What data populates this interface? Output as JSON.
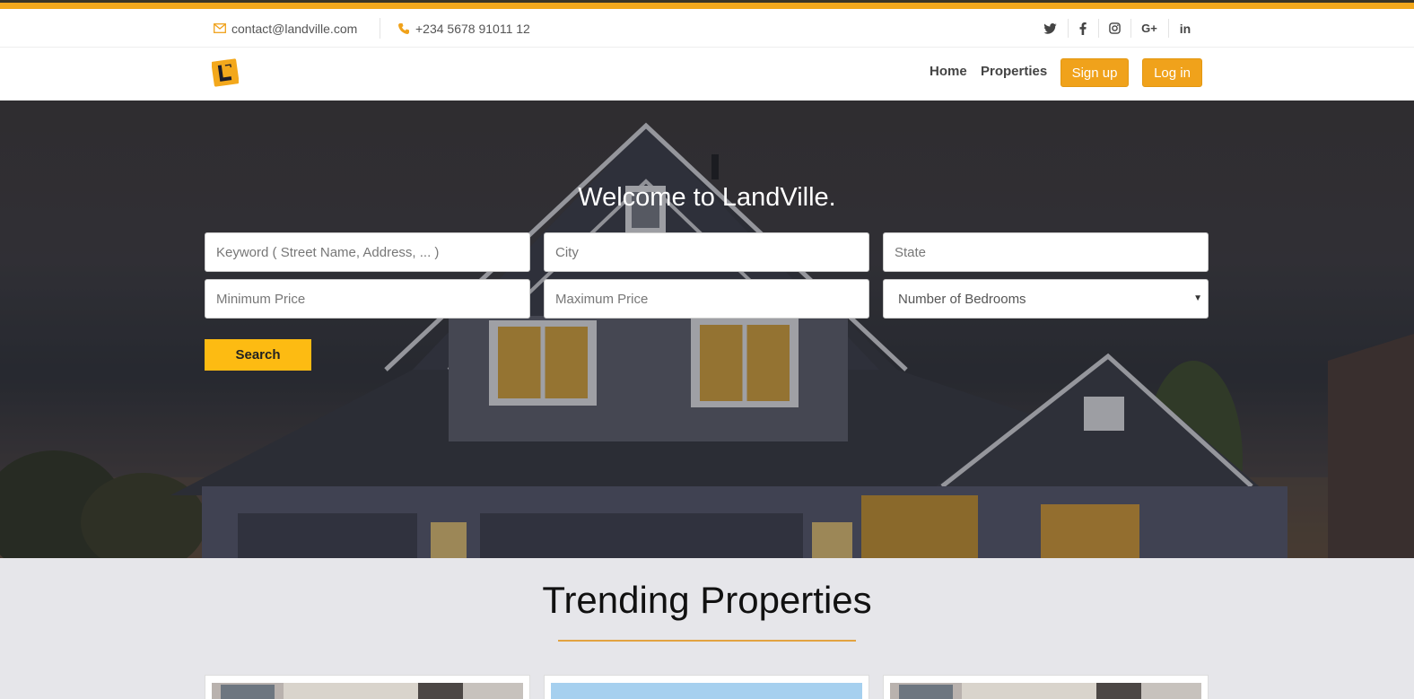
{
  "contact": {
    "email": "contact@landville.com",
    "phone": "+234 5678 91011 12"
  },
  "social": [
    {
      "icon": "twitter-icon",
      "glyph": "🐦"
    },
    {
      "icon": "facebook-icon",
      "glyph": "f"
    },
    {
      "icon": "instagram-icon",
      "glyph": "◎"
    },
    {
      "icon": "google-plus-icon",
      "glyph": "G+"
    },
    {
      "icon": "linkedin-icon",
      "glyph": "in"
    }
  ],
  "nav": {
    "home": "Home",
    "properties": "Properties",
    "signup": "Sign up",
    "login": "Log in"
  },
  "hero": {
    "title": "Welcome to LandVille.",
    "keyword_placeholder": "Keyword ( Street Name, Address, ... )",
    "city_placeholder": "City",
    "state_placeholder": "State",
    "min_price_placeholder": "Minimum Price",
    "max_price_placeholder": "Maximum Price",
    "bedrooms_selected": "Number of Bedrooms",
    "search_label": "Search"
  },
  "trending": {
    "title": "Trending Properties"
  },
  "colors": {
    "accent": "#f0a21b",
    "search_button": "#fdbb12",
    "rule": "#e2a341"
  }
}
